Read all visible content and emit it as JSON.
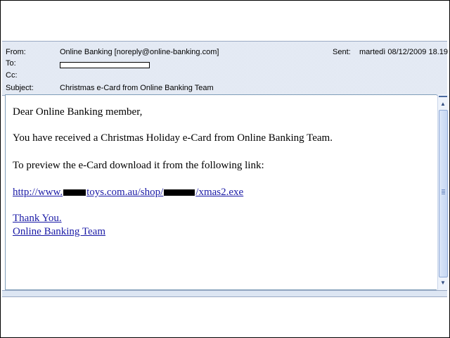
{
  "email": {
    "from_label": "From:",
    "from_value": "Online Banking [noreply@online-banking.com]",
    "to_label": "To:",
    "cc_label": "Cc:",
    "subject_label": "Subject:",
    "subject_value": "Christmas e-Card from Online Banking Team",
    "sent_label": "Sent:",
    "sent_value": "martedì 08/12/2009 18.19"
  },
  "body": {
    "greeting": "Dear Online Banking member,",
    "line1": "You have received a Christmas Holiday e-Card  from Online Banking Team.",
    "line2": "To preview the e-Card download it from the following link:",
    "link_part1": "http://www.",
    "link_part2": "toys.com.au/shop/",
    "link_part3": "/xmas2.exe",
    "thanks": "Thank You.",
    "signature": "Online Banking Team"
  }
}
